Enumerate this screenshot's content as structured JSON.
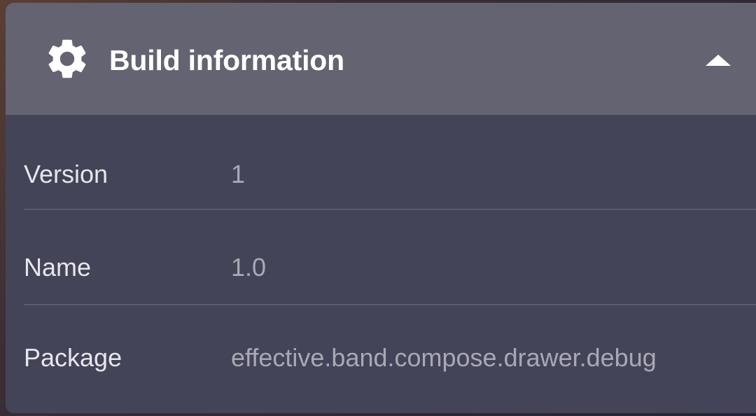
{
  "panel": {
    "title": "Build information",
    "header_icon": "gear-icon",
    "toggle_icon": "chevron-up-icon"
  },
  "rows": [
    {
      "label": "Version",
      "value": "1"
    },
    {
      "label": "Name",
      "value": "1.0"
    },
    {
      "label": "Package",
      "value": "effective.band.compose.drawer.debug"
    }
  ],
  "colors": {
    "header_bg": "#646372",
    "body_bg": "#434457",
    "title_text": "#ffffff",
    "label_text": "#e6e6ec",
    "value_text": "#a9a9b6",
    "divider": "#5a5b6c"
  }
}
